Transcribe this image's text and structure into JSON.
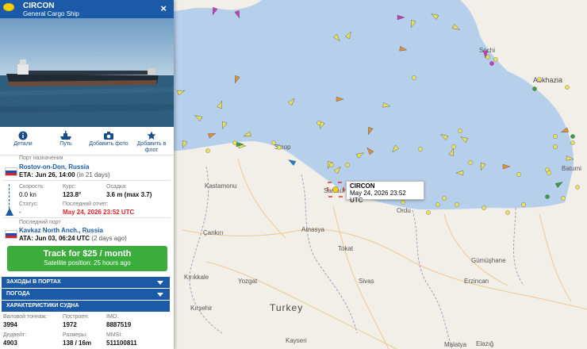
{
  "vessel": {
    "name": "CIRCON",
    "type": "General Cargo Ship",
    "close_icon": "×"
  },
  "toolbar": [
    {
      "label": "Детали",
      "icon": "info-icon"
    },
    {
      "label": "Путь",
      "icon": "ship-route-icon"
    },
    {
      "label": "Добавить фото",
      "icon": "camera-icon"
    },
    {
      "label": "Добавить в флот",
      "label2": "флот",
      "icon": "star-icon"
    }
  ],
  "destination": {
    "label": "Порт назначения",
    "port": "Rostov-on-Don, Russia",
    "eta_label": "ETA:",
    "eta": "Jun 26, 14:00",
    "eta_rel": "(in 21 days)"
  },
  "stats": {
    "speed_label": "Скорость:",
    "speed": "0.0 kn",
    "course_label": "Курс:",
    "course": "123.8°",
    "draught_label": "Осадка:",
    "draught": "3.6 m (max 3.7)",
    "status_label": "Статус:",
    "status": "-",
    "report_label": "Последний отчет:",
    "report": "May 24, 2026 23:52 UTC"
  },
  "last_port": {
    "label": "Последний порт",
    "port": "Kavkaz North Anch., Russia",
    "ata_label": "ATA:",
    "ata": "Jun 03, 06:24 UTC",
    "ata_rel": "(2 days ago)"
  },
  "track_button": {
    "title": "Track for $25 / month",
    "subtitle": "Satellite position: 25 hours ago"
  },
  "sections": [
    "ЗАХОДЫ В ПОРТАХ",
    "ПОГОДА",
    "ХАРАКТЕРИСТИКИ СУДНА"
  ],
  "specs": {
    "gt_label": "Валовой тоннаж:",
    "gt": "3994",
    "built_label": "Построен:",
    "built": "1972",
    "imo_label": "IMO:",
    "imo": "8887519",
    "dwt_label": "Дедвейт:",
    "dwt": "4903",
    "size_label": "Размеры:",
    "size": "138 / 16m",
    "mmsi_label": "MMSI:",
    "mmsi": "511100811"
  },
  "tooltip": {
    "name": "CIRCON",
    "time": "May 24, 2026 23:52 UTC"
  },
  "places": {
    "abkhazia": "Abkhazia",
    "kastamonu": "Kastamonu",
    "samsun": "Samsun",
    "cankiri": "Çankırı",
    "amasya": "Amasya",
    "tokat": "Tokat",
    "sivas": "Sivas",
    "gumushane": "Gümüşhane",
    "erzincan": "Erzincan",
    "kirikkale": "Kırıkkale",
    "yozgat": "Yozgat",
    "kirsehir": "Kırşehir",
    "turkey": "Turkey",
    "kayseri": "Kayseri",
    "malatya": "Malatya",
    "elazig": "Elazığ",
    "batumi": "Batumi",
    "ordu": "Ordu",
    "sinop": "Sinop",
    "sochi": "Sochi"
  },
  "colors": {
    "panel_header": "#1a5aa6",
    "track_button": "#3cad3c",
    "sea": "#b4cdea",
    "land": "#f2efe9",
    "report_time": "#d9262a"
  }
}
